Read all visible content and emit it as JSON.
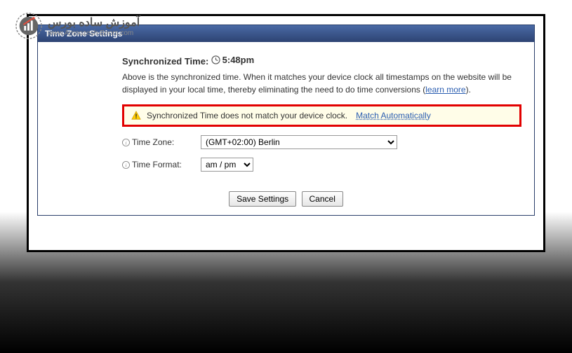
{
  "logo": {
    "arabic": "آموزش ساده بورس",
    "url": "www.Amoozesh-Boors.com"
  },
  "panel": {
    "title": "Time Zone Settings"
  },
  "sync": {
    "label": "Synchronized Time:",
    "time": "5:48pm"
  },
  "description": {
    "text1": "Above is the synchronized time. When it matches your device clock all timestamps on the website will be displayed in your local time, thereby eliminating the need to do time conversions (",
    "learn_more": "learn more",
    "text2": ")."
  },
  "warning": {
    "message": "Synchronized Time does not match your device clock.",
    "link": "Match Automatically"
  },
  "form": {
    "timezone_label": "Time Zone:",
    "timezone_value": "(GMT+02:00) Berlin",
    "timeformat_label": "Time Format:",
    "timeformat_value": "am / pm"
  },
  "buttons": {
    "save": "Save Settings",
    "cancel": "Cancel"
  }
}
